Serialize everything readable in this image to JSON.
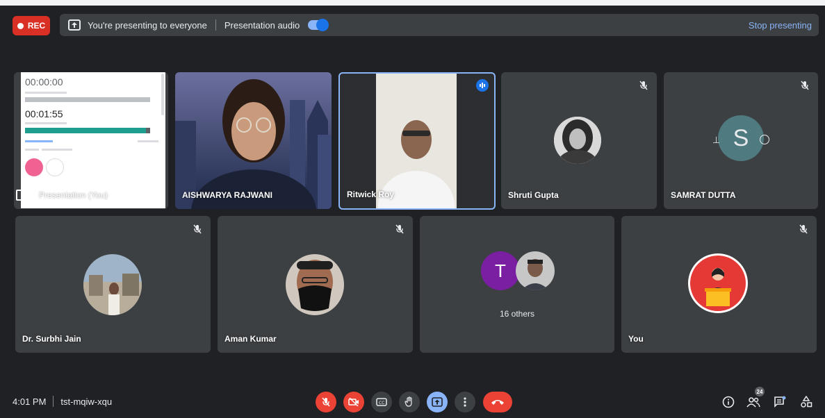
{
  "top_bar": {
    "rec_label": "REC",
    "presenting_text": "You're presenting to everyone",
    "audio_label": "Presentation audio",
    "audio_enabled": true,
    "stop_label": "Stop presenting"
  },
  "presentation_tile": {
    "timer1": "00:00:00",
    "timer2": "00:01:55",
    "label": "Presentation (You)"
  },
  "participants": [
    {
      "name": "AISHWARYA RAJWANI"
    },
    {
      "name": "Ritwick Roy"
    },
    {
      "name": "Shruti Gupta"
    },
    {
      "name": "SAMRAT DUTTA",
      "initial": "S"
    },
    {
      "name": "Dr. Surbhi Jain"
    },
    {
      "name": "Aman Kumar"
    },
    {
      "name": "You"
    }
  ],
  "others_tile": {
    "initial": "T",
    "label": "16 others"
  },
  "bottom_bar": {
    "time": "4:01 PM",
    "meeting_code": "tst-mqiw-xqu",
    "participants_count": "24"
  },
  "colors": {
    "background": "#202124",
    "tile": "#3c4043",
    "red": "#ea4335",
    "blue": "#8ab4f8",
    "purple": "#7b1fa2"
  }
}
